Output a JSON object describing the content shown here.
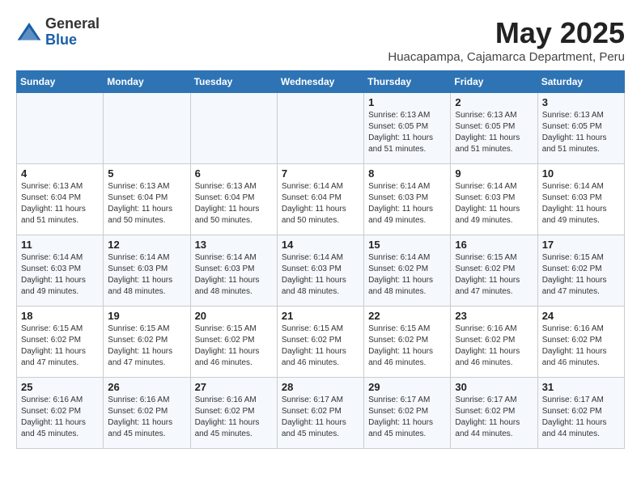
{
  "logo": {
    "general": "General",
    "blue": "Blue"
  },
  "title": "May 2025",
  "subtitle": "Huacapampa, Cajamarca Department, Peru",
  "weekdays": [
    "Sunday",
    "Monday",
    "Tuesday",
    "Wednesday",
    "Thursday",
    "Friday",
    "Saturday"
  ],
  "weeks": [
    [
      {
        "day": "",
        "info": ""
      },
      {
        "day": "",
        "info": ""
      },
      {
        "day": "",
        "info": ""
      },
      {
        "day": "",
        "info": ""
      },
      {
        "day": "1",
        "info": "Sunrise: 6:13 AM\nSunset: 6:05 PM\nDaylight: 11 hours\nand 51 minutes."
      },
      {
        "day": "2",
        "info": "Sunrise: 6:13 AM\nSunset: 6:05 PM\nDaylight: 11 hours\nand 51 minutes."
      },
      {
        "day": "3",
        "info": "Sunrise: 6:13 AM\nSunset: 6:05 PM\nDaylight: 11 hours\nand 51 minutes."
      }
    ],
    [
      {
        "day": "4",
        "info": "Sunrise: 6:13 AM\nSunset: 6:04 PM\nDaylight: 11 hours\nand 51 minutes."
      },
      {
        "day": "5",
        "info": "Sunrise: 6:13 AM\nSunset: 6:04 PM\nDaylight: 11 hours\nand 50 minutes."
      },
      {
        "day": "6",
        "info": "Sunrise: 6:13 AM\nSunset: 6:04 PM\nDaylight: 11 hours\nand 50 minutes."
      },
      {
        "day": "7",
        "info": "Sunrise: 6:14 AM\nSunset: 6:04 PM\nDaylight: 11 hours\nand 50 minutes."
      },
      {
        "day": "8",
        "info": "Sunrise: 6:14 AM\nSunset: 6:03 PM\nDaylight: 11 hours\nand 49 minutes."
      },
      {
        "day": "9",
        "info": "Sunrise: 6:14 AM\nSunset: 6:03 PM\nDaylight: 11 hours\nand 49 minutes."
      },
      {
        "day": "10",
        "info": "Sunrise: 6:14 AM\nSunset: 6:03 PM\nDaylight: 11 hours\nand 49 minutes."
      }
    ],
    [
      {
        "day": "11",
        "info": "Sunrise: 6:14 AM\nSunset: 6:03 PM\nDaylight: 11 hours\nand 49 minutes."
      },
      {
        "day": "12",
        "info": "Sunrise: 6:14 AM\nSunset: 6:03 PM\nDaylight: 11 hours\nand 48 minutes."
      },
      {
        "day": "13",
        "info": "Sunrise: 6:14 AM\nSunset: 6:03 PM\nDaylight: 11 hours\nand 48 minutes."
      },
      {
        "day": "14",
        "info": "Sunrise: 6:14 AM\nSunset: 6:03 PM\nDaylight: 11 hours\nand 48 minutes."
      },
      {
        "day": "15",
        "info": "Sunrise: 6:14 AM\nSunset: 6:02 PM\nDaylight: 11 hours\nand 48 minutes."
      },
      {
        "day": "16",
        "info": "Sunrise: 6:15 AM\nSunset: 6:02 PM\nDaylight: 11 hours\nand 47 minutes."
      },
      {
        "day": "17",
        "info": "Sunrise: 6:15 AM\nSunset: 6:02 PM\nDaylight: 11 hours\nand 47 minutes."
      }
    ],
    [
      {
        "day": "18",
        "info": "Sunrise: 6:15 AM\nSunset: 6:02 PM\nDaylight: 11 hours\nand 47 minutes."
      },
      {
        "day": "19",
        "info": "Sunrise: 6:15 AM\nSunset: 6:02 PM\nDaylight: 11 hours\nand 47 minutes."
      },
      {
        "day": "20",
        "info": "Sunrise: 6:15 AM\nSunset: 6:02 PM\nDaylight: 11 hours\nand 46 minutes."
      },
      {
        "day": "21",
        "info": "Sunrise: 6:15 AM\nSunset: 6:02 PM\nDaylight: 11 hours\nand 46 minutes."
      },
      {
        "day": "22",
        "info": "Sunrise: 6:15 AM\nSunset: 6:02 PM\nDaylight: 11 hours\nand 46 minutes."
      },
      {
        "day": "23",
        "info": "Sunrise: 6:16 AM\nSunset: 6:02 PM\nDaylight: 11 hours\nand 46 minutes."
      },
      {
        "day": "24",
        "info": "Sunrise: 6:16 AM\nSunset: 6:02 PM\nDaylight: 11 hours\nand 46 minutes."
      }
    ],
    [
      {
        "day": "25",
        "info": "Sunrise: 6:16 AM\nSunset: 6:02 PM\nDaylight: 11 hours\nand 45 minutes."
      },
      {
        "day": "26",
        "info": "Sunrise: 6:16 AM\nSunset: 6:02 PM\nDaylight: 11 hours\nand 45 minutes."
      },
      {
        "day": "27",
        "info": "Sunrise: 6:16 AM\nSunset: 6:02 PM\nDaylight: 11 hours\nand 45 minutes."
      },
      {
        "day": "28",
        "info": "Sunrise: 6:17 AM\nSunset: 6:02 PM\nDaylight: 11 hours\nand 45 minutes."
      },
      {
        "day": "29",
        "info": "Sunrise: 6:17 AM\nSunset: 6:02 PM\nDaylight: 11 hours\nand 45 minutes."
      },
      {
        "day": "30",
        "info": "Sunrise: 6:17 AM\nSunset: 6:02 PM\nDaylight: 11 hours\nand 44 minutes."
      },
      {
        "day": "31",
        "info": "Sunrise: 6:17 AM\nSunset: 6:02 PM\nDaylight: 11 hours\nand 44 minutes."
      }
    ]
  ]
}
